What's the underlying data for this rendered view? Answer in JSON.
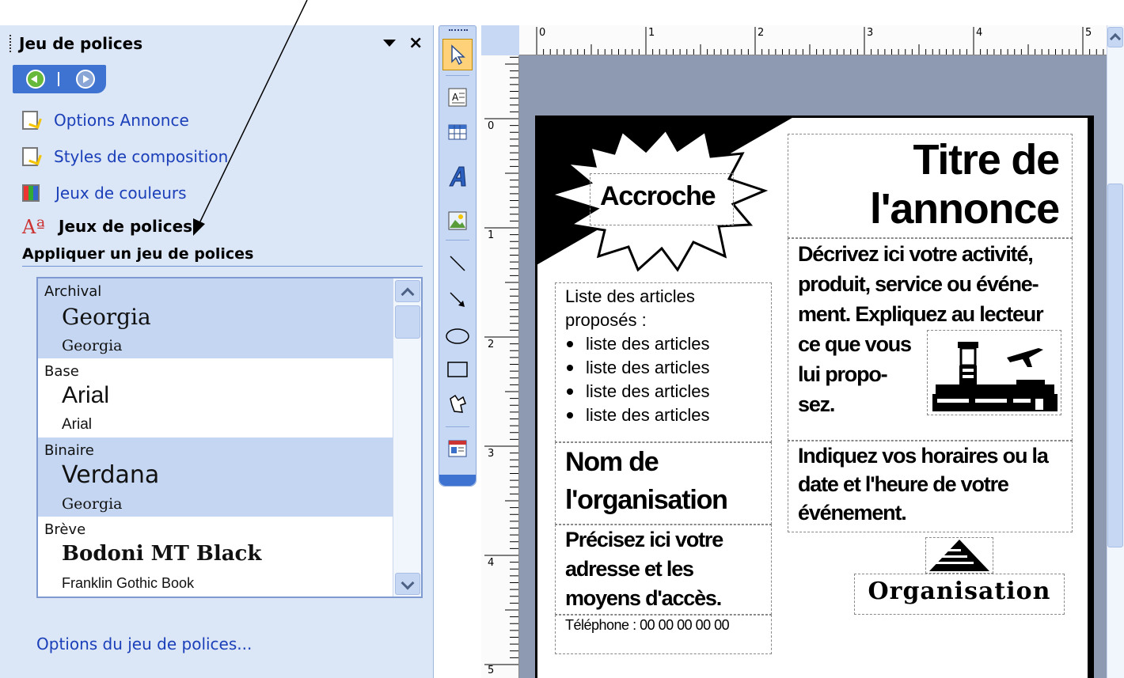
{
  "taskpane": {
    "title": "Jeu de polices",
    "close_glyph": "×",
    "links": [
      {
        "label": "Options Annonce",
        "icon": "publication-options-icon"
      },
      {
        "label": "Styles de composition",
        "icon": "design-styles-icon"
      },
      {
        "label": "Jeux de couleurs",
        "icon": "color-schemes-icon"
      },
      {
        "label": "Jeux de polices",
        "icon": "font-schemes-icon",
        "glyph": "Aª"
      }
    ],
    "section_title": "Appliquer un jeu de polices",
    "font_schemes": [
      {
        "name": "Archival",
        "heading": "Georgia",
        "body": "Georgia",
        "selected": true
      },
      {
        "name": "Base",
        "heading": "Arial",
        "body": "Arial",
        "selected": false
      },
      {
        "name": "Binaire",
        "heading": "Verdana",
        "body": "Georgia",
        "selected": true
      },
      {
        "name": "Brève",
        "heading": "Bodoni MT Black",
        "body": "Franklin Gothic Book",
        "selected": false
      }
    ],
    "options_link": "Options du jeu de polices..."
  },
  "ruler": {
    "top_numbers": [
      "0",
      "1",
      "2",
      "3",
      "4",
      "5"
    ],
    "left_numbers": [
      "0",
      "1",
      "2",
      "3",
      "4",
      "5"
    ]
  },
  "flyer": {
    "accroche": "Accroche",
    "title_line1": "Titre de",
    "title_line2": "l'annonce",
    "description": [
      "Décrivez ici votre activité,",
      "produit, service ou événe-",
      "ment. Expliquez au lecteur",
      "ce que vous",
      "lui propo-",
      "sez."
    ],
    "list_intro": [
      "Liste des articles",
      "proposés :"
    ],
    "list_items": [
      "liste des articles",
      "liste des articles",
      "liste des articles",
      "liste des articles"
    ],
    "org_name": [
      "Nom de",
      "l'organisation"
    ],
    "hours": [
      "Indiquez vos horaires ou la",
      "date et l'heure de votre",
      "événement."
    ],
    "address": [
      "Précisez ici votre",
      "adresse et les",
      "moyens d'accès."
    ],
    "phone": "Téléphone : 00 00 00 00 00",
    "logo_text": "Organisation"
  },
  "colors": {
    "taskpane_bg": "#dbe6f7",
    "link_blue": "#1a3fb8",
    "selection_bg": "#c4d6f1",
    "canvas_bg": "#8e9ab1"
  }
}
